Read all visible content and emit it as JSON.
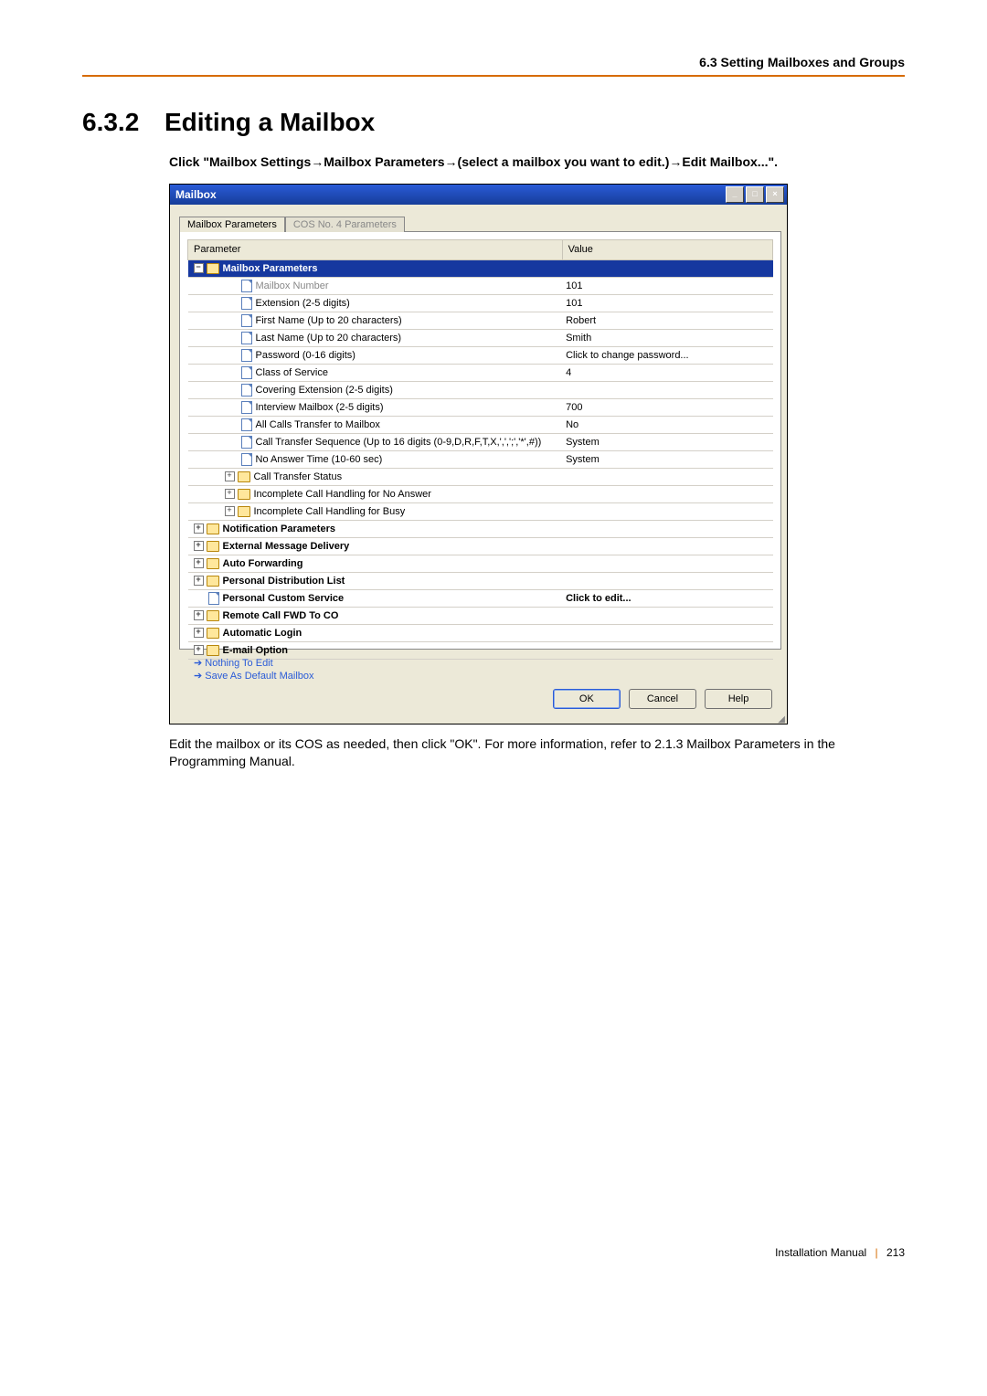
{
  "header": {
    "breadcrumb": "6.3 Setting Mailboxes and Groups"
  },
  "section": {
    "number": "6.3.2",
    "title": "Editing a Mailbox",
    "instruction_parts": [
      "Click \"Mailbox Settings",
      "Mailbox Parameters",
      "(select a mailbox you want to edit.)",
      "Edit Mailbox...\"."
    ]
  },
  "window": {
    "title": "Mailbox",
    "tabs": {
      "active": "Mailbox Parameters",
      "inactive": "COS No. 4 Parameters"
    },
    "columns": {
      "param": "Parameter",
      "value": "Value"
    },
    "group_label": "Mailbox Parameters",
    "rows": [
      {
        "label": "Mailbox Number",
        "value": "101",
        "indent": 2,
        "icon": "doc",
        "disabled": true
      },
      {
        "label": "Extension (2-5 digits)",
        "value": "101",
        "indent": 2,
        "icon": "doc"
      },
      {
        "label": "First Name (Up to 20 characters)",
        "value": "Robert",
        "indent": 2,
        "icon": "doc"
      },
      {
        "label": "Last Name (Up to 20 characters)",
        "value": "Smith",
        "indent": 2,
        "icon": "doc"
      },
      {
        "label": "Password (0-16 digits)",
        "value": "Click to change password...",
        "indent": 2,
        "icon": "doc"
      },
      {
        "label": "Class of Service",
        "value": "4",
        "indent": 2,
        "icon": "doc"
      },
      {
        "label": "Covering Extension (2-5 digits)",
        "value": "",
        "indent": 2,
        "icon": "doc"
      },
      {
        "label": "Interview Mailbox (2-5 digits)",
        "value": "700",
        "indent": 2,
        "icon": "doc"
      },
      {
        "label": "All Calls Transfer to Mailbox",
        "value": "No",
        "indent": 2,
        "icon": "doc"
      },
      {
        "label": "Call Transfer Sequence (Up to 16 digits (0-9,D,R,F,T,X,',',';','*',#))",
        "value": "System",
        "indent": 2,
        "icon": "doc"
      },
      {
        "label": "No Answer Time (10-60 sec)",
        "value": "System",
        "indent": 2,
        "icon": "doc"
      },
      {
        "label": "Call Transfer Status",
        "value": "",
        "indent": 3,
        "icon": "folder",
        "box": "+"
      },
      {
        "label": "Incomplete Call Handling for No Answer",
        "value": "",
        "indent": 3,
        "icon": "folder",
        "box": "+"
      },
      {
        "label": "Incomplete Call Handling for Busy",
        "value": "",
        "indent": 3,
        "icon": "folder",
        "box": "+"
      },
      {
        "label": "Notification Parameters",
        "value": "",
        "indent": 0,
        "icon": "folder",
        "box": "+",
        "bold": true
      },
      {
        "label": "External Message Delivery",
        "value": "",
        "indent": 0,
        "icon": "folder",
        "box": "+",
        "bold": true
      },
      {
        "label": "Auto Forwarding",
        "value": "",
        "indent": 0,
        "icon": "folder",
        "box": "+",
        "bold": true
      },
      {
        "label": "Personal Distribution List",
        "value": "",
        "indent": 0,
        "icon": "folder",
        "box": "+",
        "bold": true
      },
      {
        "label": "Personal Custom Service",
        "value": "Click to edit...",
        "indent": 1,
        "icon": "doc",
        "bold": true
      },
      {
        "label": "Remote Call FWD To CO",
        "value": "",
        "indent": 0,
        "icon": "folder",
        "box": "+",
        "bold": true
      },
      {
        "label": "Automatic Login",
        "value": "",
        "indent": 0,
        "icon": "folder",
        "box": "+",
        "bold": true
      },
      {
        "label": "E-mail Option",
        "value": "",
        "indent": 0,
        "icon": "folder",
        "box": "+",
        "bold": true
      }
    ],
    "links": {
      "nothing_to_edit": "Nothing To Edit",
      "save_default": "Save As Default Mailbox"
    },
    "buttons": {
      "ok": "OK",
      "cancel": "Cancel",
      "help": "Help"
    }
  },
  "body_text": "Edit the mailbox or its COS as needed, then click \"OK\". For more information, refer to 2.1.3 Mailbox Parameters in the Programming Manual.",
  "footer": {
    "doc": "Installation Manual",
    "page": "213"
  }
}
